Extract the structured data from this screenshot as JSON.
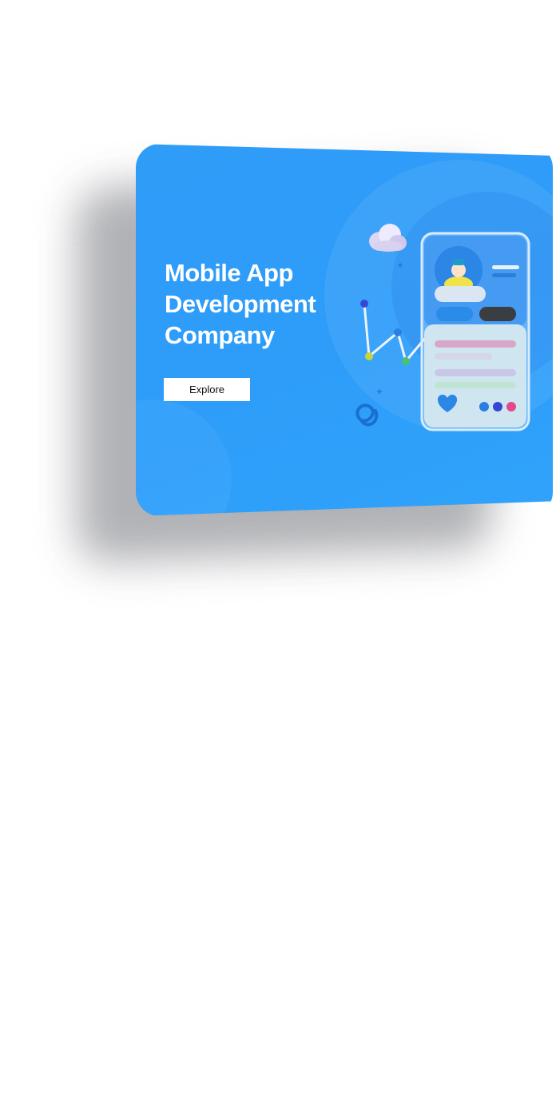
{
  "hero": {
    "headline": [
      "Mobile App",
      "Development",
      "Company"
    ],
    "cta_label": "Explore"
  },
  "colors": {
    "card": "#2d9df9",
    "button": "#ffffff",
    "headline": "#ffffff"
  },
  "icons": [
    "cloud-icon",
    "sparkle-icon",
    "spiral-icon",
    "heart-icon",
    "avatar-icon"
  ]
}
